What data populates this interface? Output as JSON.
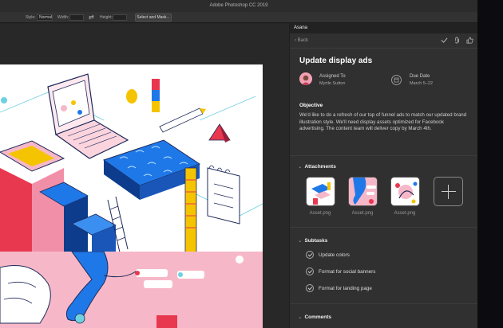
{
  "window": {
    "title": "Adobe Photoshop CC 2019"
  },
  "options_bar": {
    "style_label": "Style:",
    "style_value": "Normal",
    "width_label": "Width:",
    "height_label": "Height:",
    "swap_icon": "swap-arrows-icon",
    "select_mask_label": "Select and Mask..."
  },
  "asana": {
    "tab_label": "Asana",
    "back_label": "Back",
    "top_icons": [
      "check-icon",
      "attach-icon",
      "thumbs-up-icon"
    ],
    "task_title": "Update display ads",
    "assigned_label": "Assigned To",
    "assignee": "Myrtle Sutton",
    "due_label": "Due Date",
    "due_value": "March 5–22",
    "objective_heading": "Objective",
    "objective_body": "We'd like to do a refresh of our top of funnel ads to match our updated brand illustration style. We'll need display assets optimized for Facebook advertising. The content team will deliver copy by March 4th.",
    "attachments_heading": "Attachments",
    "attachments": [
      {
        "label": "Asset.png"
      },
      {
        "label": "Asset.png"
      },
      {
        "label": "Asset.png"
      }
    ],
    "subtasks_heading": "Subtasks",
    "subtasks": [
      {
        "label": "Update colors"
      },
      {
        "label": "Format for social banners"
      },
      {
        "label": "Format for landing page"
      }
    ],
    "comments_heading": "Comments"
  },
  "colors": {
    "ps_bg": "#262626",
    "panel_bg": "#303030",
    "accent_blue": "#1f78e8",
    "accent_pink": "#f6b8c8",
    "accent_red": "#e8384f",
    "accent_yellow": "#f5c400"
  }
}
